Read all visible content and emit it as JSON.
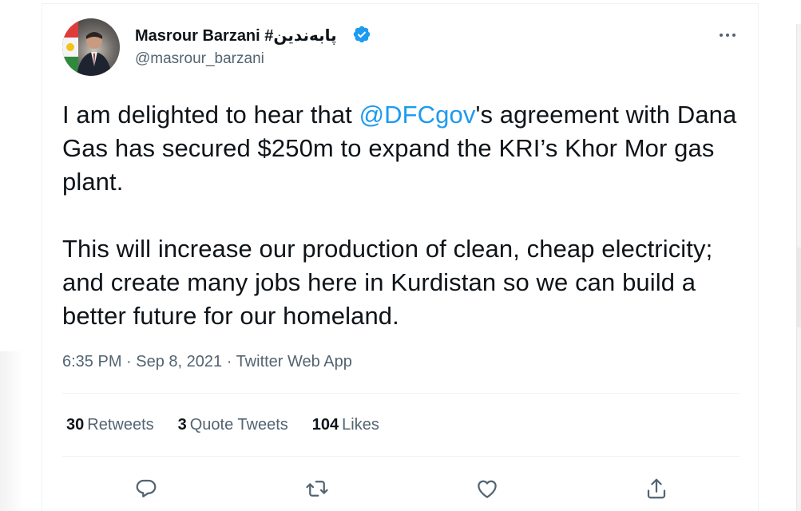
{
  "author": {
    "name": "Masrour Barzani #پابەندین",
    "handle": "@masrour_barzani",
    "verified": true
  },
  "tweet": {
    "line1_before": "I am delighted to hear that ",
    "mention": "@DFCgov",
    "line1_after": "'s agreement with Dana Gas has secured $250m to expand the KRI’s Khor Mor gas plant.",
    "paragraph2": "This will increase our production of clean, cheap electricity; and create many jobs here in Kurdistan so we can build a better future for our homeland."
  },
  "meta": {
    "time": "6:35 PM",
    "separator": " · ",
    "date": "Sep 8, 2021",
    "app": "Twitter Web App"
  },
  "stats": [
    {
      "count": "30",
      "label": "Retweets"
    },
    {
      "count": "3",
      "label": "Quote Tweets"
    },
    {
      "count": "104",
      "label": "Likes"
    }
  ],
  "actions": {
    "icons": [
      "reply-icon",
      "retweet-icon",
      "like-icon",
      "share-icon"
    ]
  },
  "colors": {
    "accent": "#1d9bf0",
    "text_primary": "#0f1419",
    "text_secondary": "#536471",
    "divider": "#eff3f4"
  }
}
